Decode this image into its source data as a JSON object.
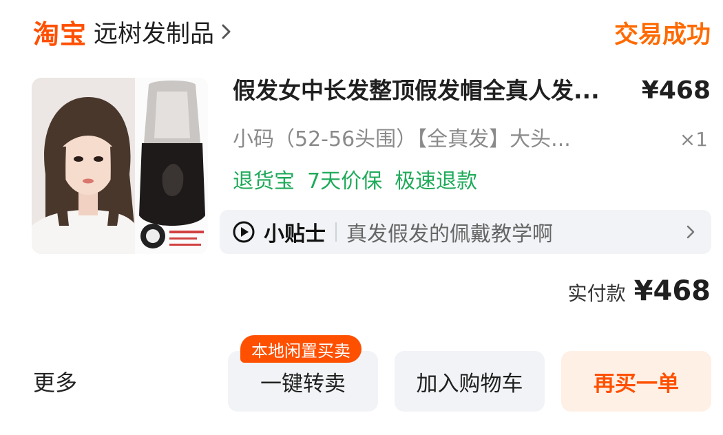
{
  "header": {
    "brand": "淘宝",
    "shop_name": "远树发制品",
    "status": "交易成功"
  },
  "product": {
    "title": "假发女中长发整顶假发帽全真人发...",
    "price": "¥468",
    "spec": "小码（52-56头围）【全真发】大头...",
    "quantity": "×1",
    "services": [
      "退货宝",
      "7天价保",
      "极速退款"
    ]
  },
  "tip": {
    "title": "小贴士",
    "text": "真发假发的佩戴教学啊"
  },
  "payment": {
    "label": "实付款",
    "value": "¥468"
  },
  "actions": {
    "more": "更多",
    "resell_badge": "本地闲置买卖",
    "resell": "一键转卖",
    "add_cart": "加入购物车",
    "rebuy": "再买一单"
  },
  "colors": {
    "brand": "#ff5000",
    "status": "#ff6a00",
    "service": "#1faa5a",
    "button_bg": "#f1f3f6",
    "rebuy_bg": "#fff0e6"
  },
  "icons": {
    "shop_chevron": "chevron-right-icon",
    "tip_play": "play-circle-icon",
    "tip_chevron": "chevron-right-icon"
  }
}
